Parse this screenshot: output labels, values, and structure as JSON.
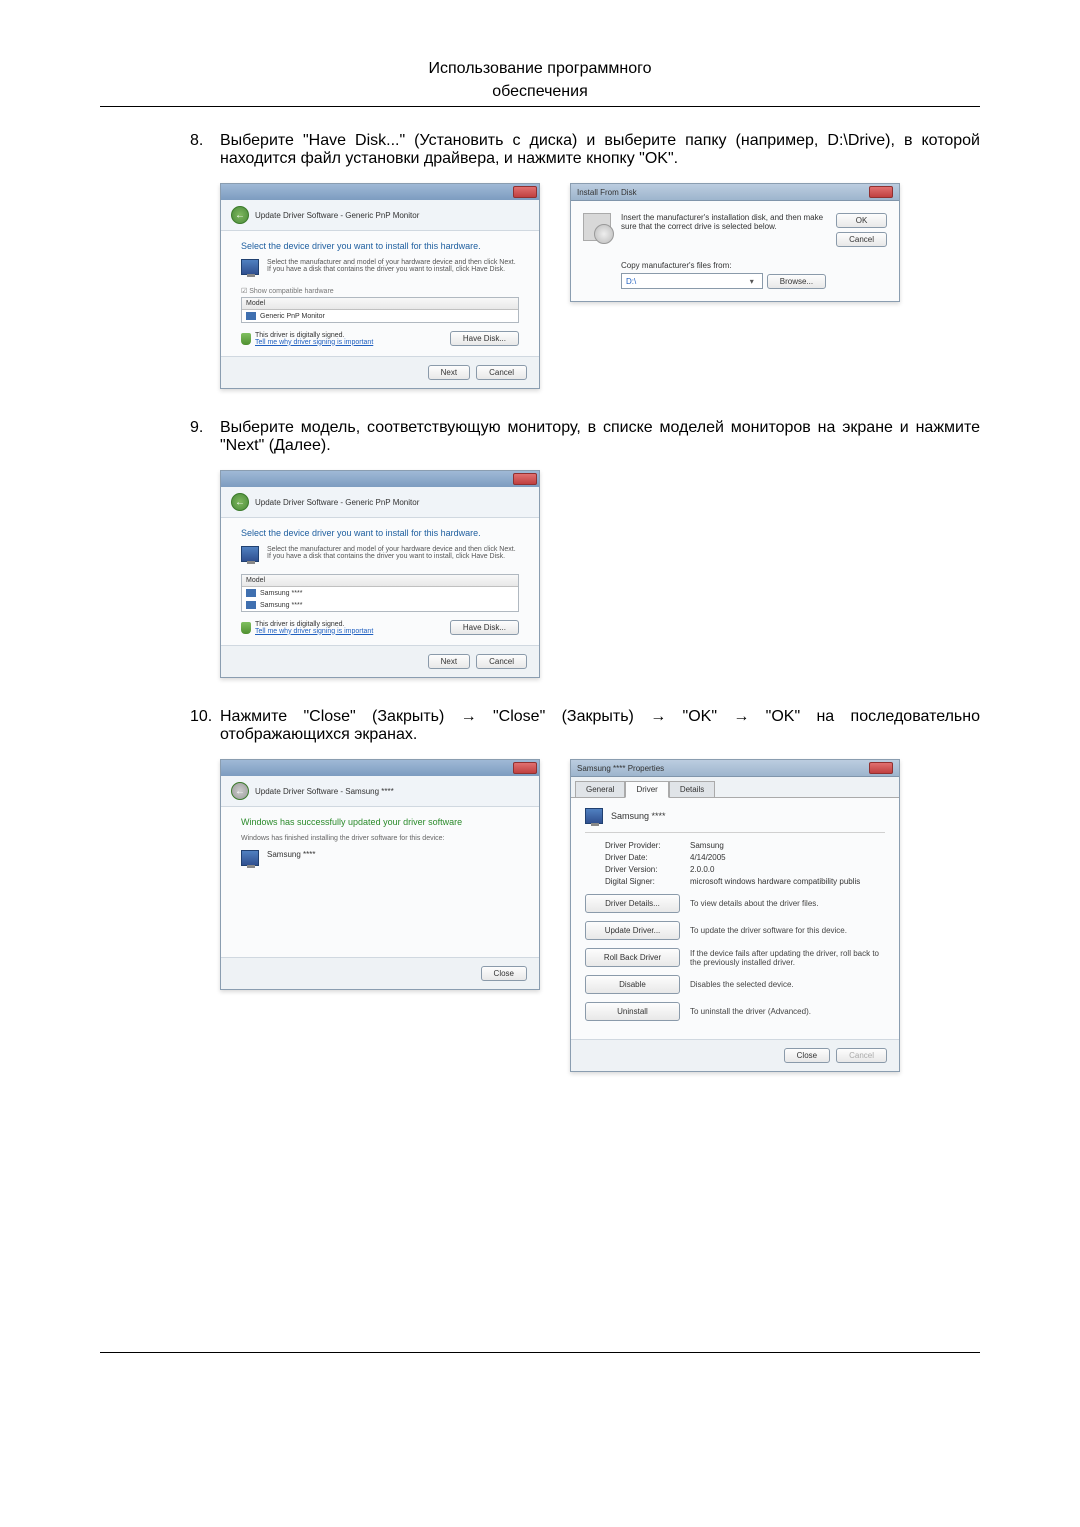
{
  "header": {
    "line1": "Использование программного",
    "line2": "обеспечения"
  },
  "steps": {
    "s8": {
      "num": "8.",
      "text": "Выберите \"Have Disk...\" (Установить с диска) и выберите папку (например, D:\\Drive), в которой находится файл установки драйвера, и нажмите кнопку \"OK\"."
    },
    "s9": {
      "num": "9.",
      "text": "Выберите модель, соответствующую монитору, в списке моделей мониторов на экране и нажмите \"Next\" (Далее)."
    },
    "s10": {
      "num": "10.",
      "text": "Нажмите \"Close\" (Закрыть) → \"Close\" (Закрыть) → \"OK\" → \"OK\" на последовательно отображающихся экранах."
    }
  },
  "dlg1": {
    "breadcrumb": "Update Driver Software - Generic PnP Monitor",
    "heading": "Select the device driver you want to install for this hardware.",
    "info": "Select the manufacturer and model of your hardware device and then click Next. If you have a disk that contains the driver you want to install, click Have Disk.",
    "compat": "Show compatible hardware",
    "model_header": "Model",
    "model_item": "Generic PnP Monitor",
    "signed": "This driver is digitally signed.",
    "tell": "Tell me why driver signing is important",
    "have_disk": "Have Disk...",
    "next": "Next",
    "cancel": "Cancel"
  },
  "install": {
    "title": "Install From Disk",
    "msg": "Insert the manufacturer's installation disk, and then make sure that the correct drive is selected below.",
    "ok": "OK",
    "cancel": "Cancel",
    "copy": "Copy manufacturer's files from:",
    "path": "D:\\",
    "browse": "Browse..."
  },
  "dlg2": {
    "breadcrumb": "Update Driver Software - Generic PnP Monitor",
    "heading": "Select the device driver you want to install for this hardware.",
    "info": "Select the manufacturer and model of your hardware device and then click Next. If you have a disk that contains the driver you want to install, click Have Disk.",
    "model_header": "Model",
    "item1": "Samsung ****",
    "item2": "Samsung ****",
    "signed": "This driver is digitally signed.",
    "tell": "Tell me why driver signing is important",
    "have_disk": "Have Disk...",
    "next": "Next",
    "cancel": "Cancel"
  },
  "dlg3": {
    "breadcrumb": "Update Driver Software - Samsung ****",
    "heading": "Windows has successfully updated your driver software",
    "sub": "Windows has finished installing the driver software for this device:",
    "device": "Samsung ****",
    "close": "Close"
  },
  "props": {
    "title": "Samsung **** Properties",
    "tab_general": "General",
    "tab_driver": "Driver",
    "tab_details": "Details",
    "device": "Samsung ****",
    "provider_l": "Driver Provider:",
    "provider_v": "Samsung",
    "date_l": "Driver Date:",
    "date_v": "4/14/2005",
    "version_l": "Driver Version:",
    "version_v": "2.0.0.0",
    "signer_l": "Digital Signer:",
    "signer_v": "microsoft windows hardware compatibility publis",
    "details_btn": "Driver Details...",
    "details_desc": "To view details about the driver files.",
    "update_btn": "Update Driver...",
    "update_desc": "To update the driver software for this device.",
    "rollback_btn": "Roll Back Driver",
    "rollback_desc": "If the device fails after updating the driver, roll back to the previously installed driver.",
    "disable_btn": "Disable",
    "disable_desc": "Disables the selected device.",
    "uninstall_btn": "Uninstall",
    "uninstall_desc": "To uninstall the driver (Advanced).",
    "close": "Close",
    "cancel": "Cancel"
  }
}
